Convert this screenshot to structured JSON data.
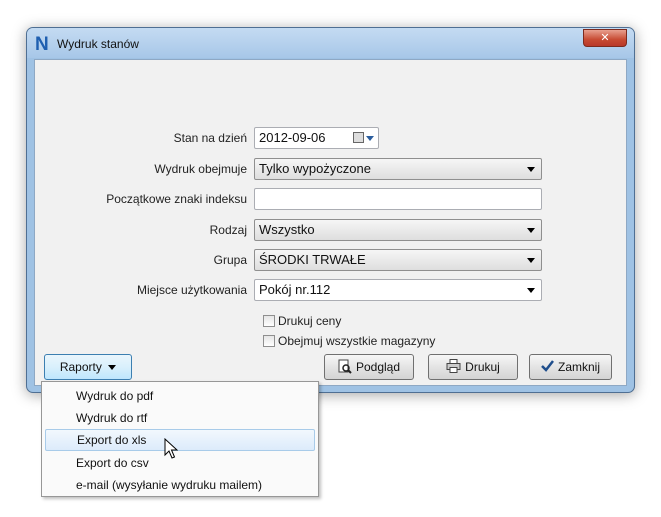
{
  "window": {
    "title": "Wydruk stanów",
    "app_icon_letter": "N",
    "close_symbol": "✕"
  },
  "form": {
    "stan_na_dzien": {
      "label": "Stan na dzień",
      "value": "2012-09-06"
    },
    "wydruk_obejmuje": {
      "label": "Wydruk obejmuje",
      "value": "Tylko wypożyczone"
    },
    "poczatkowe_znaki": {
      "label": "Początkowe znaki indeksu",
      "value": ""
    },
    "rodzaj": {
      "label": "Rodzaj",
      "value": "Wszystko"
    },
    "grupa": {
      "label": "Grupa",
      "value": "ŚRODKI TRWAŁE"
    },
    "miejsce": {
      "label": "Miejsce użytkowania",
      "value": "Pokój nr.112"
    },
    "drukuj_ceny": {
      "label": "Drukuj ceny",
      "checked": false
    },
    "wszystkie_magazyny": {
      "label": "Obejmuj wszystkie magazyny",
      "checked": false
    }
  },
  "buttons": {
    "raporty": "Raporty",
    "podglad": "Podgląd",
    "drukuj": "Drukuj",
    "zamknij": "Zamknij"
  },
  "menu": {
    "items": [
      {
        "label": "Wydruk do pdf"
      },
      {
        "label": "Wydruk do rtf"
      },
      {
        "label": "Export do xls",
        "highlighted": true
      },
      {
        "label": "Export do csv"
      },
      {
        "label": "e-mail (wysyłanie wydruku mailem)"
      }
    ]
  },
  "colors": {
    "titlebar": "#a7c7e8",
    "close_button": "#c74a32",
    "client_background": "#f1f1f1",
    "menu_highlight": "#dcebfb",
    "check_mark": "#1f4e8c"
  },
  "icons": {
    "app": "n-logo-icon",
    "preview": "magnifier-page-icon",
    "print": "printer-icon",
    "close": "checkmark-icon",
    "calendar": "calendar-icon"
  }
}
